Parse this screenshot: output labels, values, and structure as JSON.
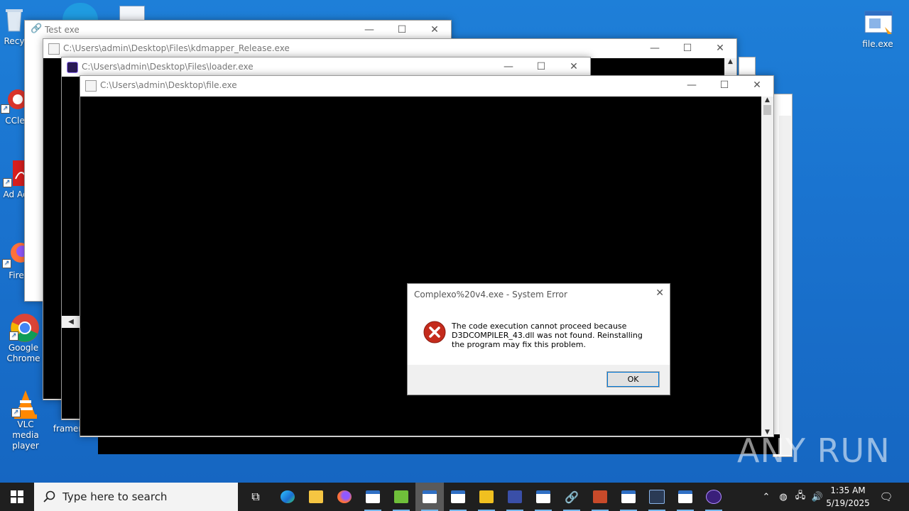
{
  "desktop": {
    "icons_left": [
      {
        "label": "Recy",
        "icon": "recycle-bin-icon"
      },
      {
        "label": "CCle",
        "icon": "ccleaner-icon"
      },
      {
        "label": "Ad Acr",
        "icon": "acrobat-icon"
      },
      {
        "label": "Fire",
        "icon": "firefox-icon"
      },
      {
        "label": "Google Chrome",
        "icon": "chrome-icon"
      },
      {
        "label": "VLC media player",
        "icon": "vlc-icon"
      },
      {
        "label": "framer",
        "icon": "framer-icon"
      }
    ],
    "file_icon_label": "file.exe",
    "watermark": "ANY RUN"
  },
  "windows": {
    "test": {
      "title": "Test exe"
    },
    "kdmapper": {
      "title": "C:\\Users\\admin\\Desktop\\Files\\kdmapper_Release.exe"
    },
    "loader": {
      "title": "C:\\Users\\admin\\Desktop\\Files\\loader.exe"
    },
    "file": {
      "title": "C:\\Users\\admin\\Desktop\\file.exe"
    }
  },
  "caption_buttons": {
    "minimize": "—",
    "maximize": "☐",
    "close": "✕"
  },
  "dialog": {
    "title": "Complexo%20v4.exe - System Error",
    "message": "The code execution cannot proceed because D3DCOMPILER_43.dll was not found. Reinstalling the program may fix this problem.",
    "ok_label": "OK",
    "close_glyph": "✕"
  },
  "taskbar": {
    "search_placeholder": "Type here to search",
    "time": "1:35 AM",
    "date": "5/19/2025",
    "apps": [
      "task-view",
      "edge",
      "file-explorer",
      "firefox",
      "console",
      "3h-app",
      "console-active",
      "console",
      "bin-app",
      "network-app",
      "console",
      "link-app",
      "installer-app",
      "console",
      "remote-desktop",
      "console",
      "loader-app"
    ]
  },
  "colors": {
    "accent": "#0078d7",
    "error": "#c42b1c",
    "taskbar": "#1f1f1f"
  }
}
